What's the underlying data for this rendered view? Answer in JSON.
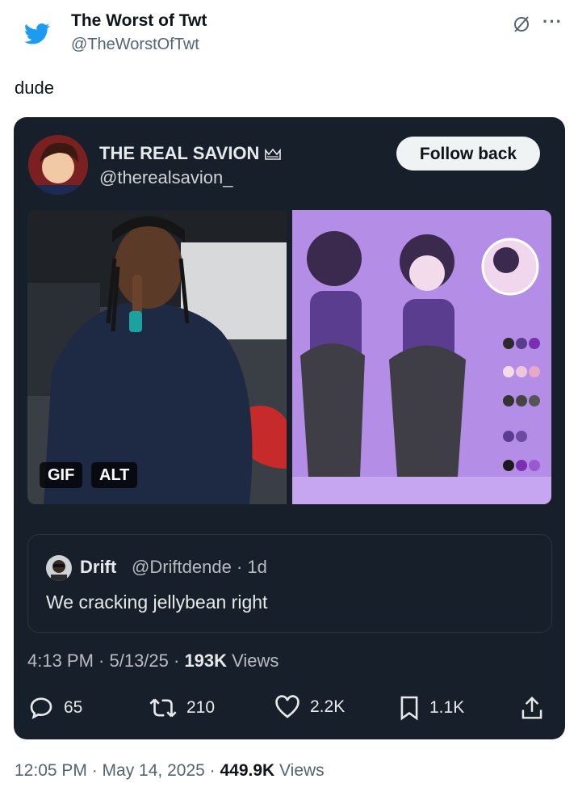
{
  "outer": {
    "name": "The Worst of Twt",
    "handle": "@TheWorstOfTwt",
    "text": "dude",
    "more": "···"
  },
  "inner": {
    "name": "THE REAL SAVION",
    "handle": "@therealsavion_",
    "follow_label": "Follow back",
    "badges": {
      "gif": "GIF",
      "alt": "ALT"
    },
    "quote": {
      "name": "Drift",
      "meta": "@Driftdende · 1d",
      "text": "We cracking jellybean right"
    },
    "stats": {
      "time": "4:13 PM · 5/13/25 · ",
      "views_count": "193K",
      "views_label": " Views"
    },
    "actions": {
      "replies": "65",
      "retweets": "210",
      "likes": "2.2K",
      "bookmarks": "1.1K"
    }
  },
  "footer": {
    "time": "12:05 PM · May 14, 2025 · ",
    "views_count": "449.9K",
    "views_label": " Views"
  },
  "colors": {
    "card_bg": "#17202a",
    "twitter_blue": "#1d9bf0",
    "art_bg": "#b48ee6"
  },
  "icons": [
    "twitter-bird-icon",
    "hide-icon",
    "crown-icon",
    "reply-icon",
    "retweet-icon",
    "like-icon",
    "bookmark-icon",
    "share-icon"
  ]
}
